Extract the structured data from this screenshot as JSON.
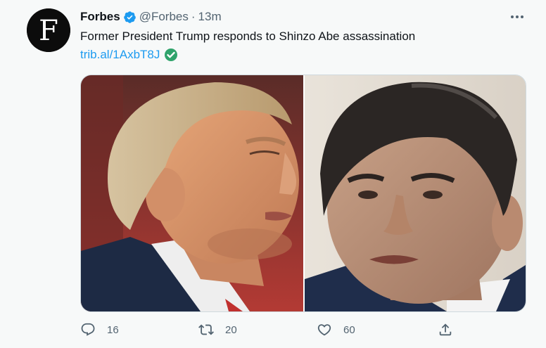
{
  "tweet": {
    "author_name": "Forbes",
    "handle": "@Forbes",
    "separator": "·",
    "time": "13m",
    "text": "Former President Trump responds to Shinzo Abe assassination",
    "link": "trib.al/1AxbT8J",
    "avatar_letter": "F"
  },
  "actions": {
    "reply_count": "16",
    "retweet_count": "20",
    "like_count": "60"
  },
  "icons": {
    "verified": "verified-badge-icon",
    "more": "more-icon",
    "reply": "reply-icon",
    "retweet": "retweet-icon",
    "like": "heart-icon",
    "share": "share-icon",
    "check": "white-check-mark-emoji"
  },
  "colors": {
    "link": "#1d9bf0",
    "secondary_text": "#536471",
    "verified": "#1d9bf0",
    "check_emoji": "#2fa36b"
  }
}
